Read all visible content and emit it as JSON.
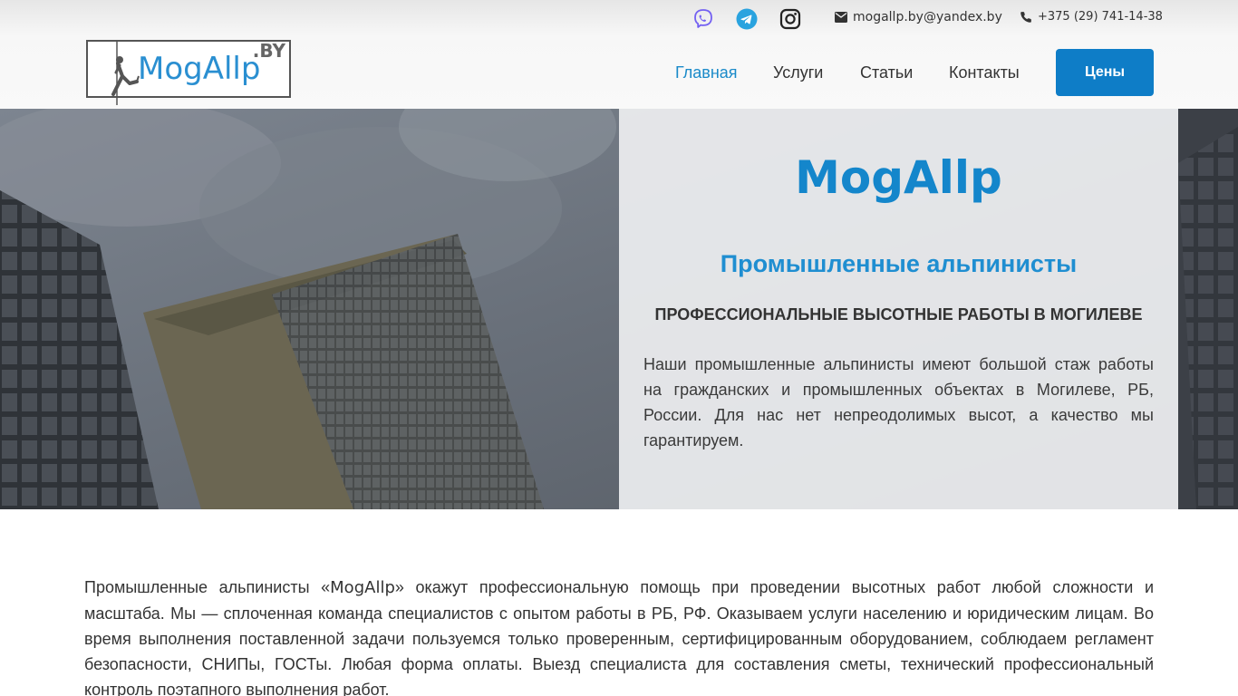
{
  "topbar": {
    "social": [
      {
        "icon": "viber-icon",
        "color": "#7360f2"
      },
      {
        "icon": "telegram-icon",
        "color": "#2aa3df"
      },
      {
        "icon": "instagram-icon",
        "color": "#222222"
      }
    ],
    "email": {
      "icon": "envelope-icon",
      "text": "mogallp.by@yandex.by"
    },
    "phone": {
      "icon": "phone-icon",
      "text": "+375 (29) 741-14-38"
    }
  },
  "logo": {
    "text": "MogAllp",
    "suffix": ".BY"
  },
  "nav": {
    "items": [
      {
        "label": "Главная",
        "active": true
      },
      {
        "label": "Услуги",
        "active": false
      },
      {
        "label": "Статьи",
        "active": false
      },
      {
        "label": "Контакты",
        "active": false
      }
    ],
    "cta_label": "Цены"
  },
  "hero": {
    "title": "MogAllp",
    "subtitle": "Промышленные альпинисты",
    "caps": "ПРОФЕССИОНАЛЬНЫЕ ВЫСОТНЫЕ РАБОТЫ В МОГИЛЕВЕ",
    "text": "Наши промышленные альпинисты имеют большой стаж работы на гражданских и промышленных объектах в Могилеве, РБ, России. Для нас нет непреодолимых высот, а качество мы гарантируем."
  },
  "intro": {
    "before_brand": "Промышленные альпинисты «",
    "brand": "MogAllp",
    "after_brand": "» окажут профессиональную помощь при проведении высотных работ любой сложности и масштаба. Мы — сплоченная команда специалистов с опытом работы в РБ, РФ. Оказываем услуги населению и юридическим лицам. Во время выполнения поставленной задачи пользуемся только проверенным, сертифицированным оборудованием, соблюдаем регламент безопасности, СНИПы, ГОСТы. Любая форма оплаты. Выезд специалиста для составления сметы, технический профессиональный контроль поэтапного выполнения работ."
  },
  "colors": {
    "accent": "#1486cb",
    "button": "#0e7dc7"
  }
}
